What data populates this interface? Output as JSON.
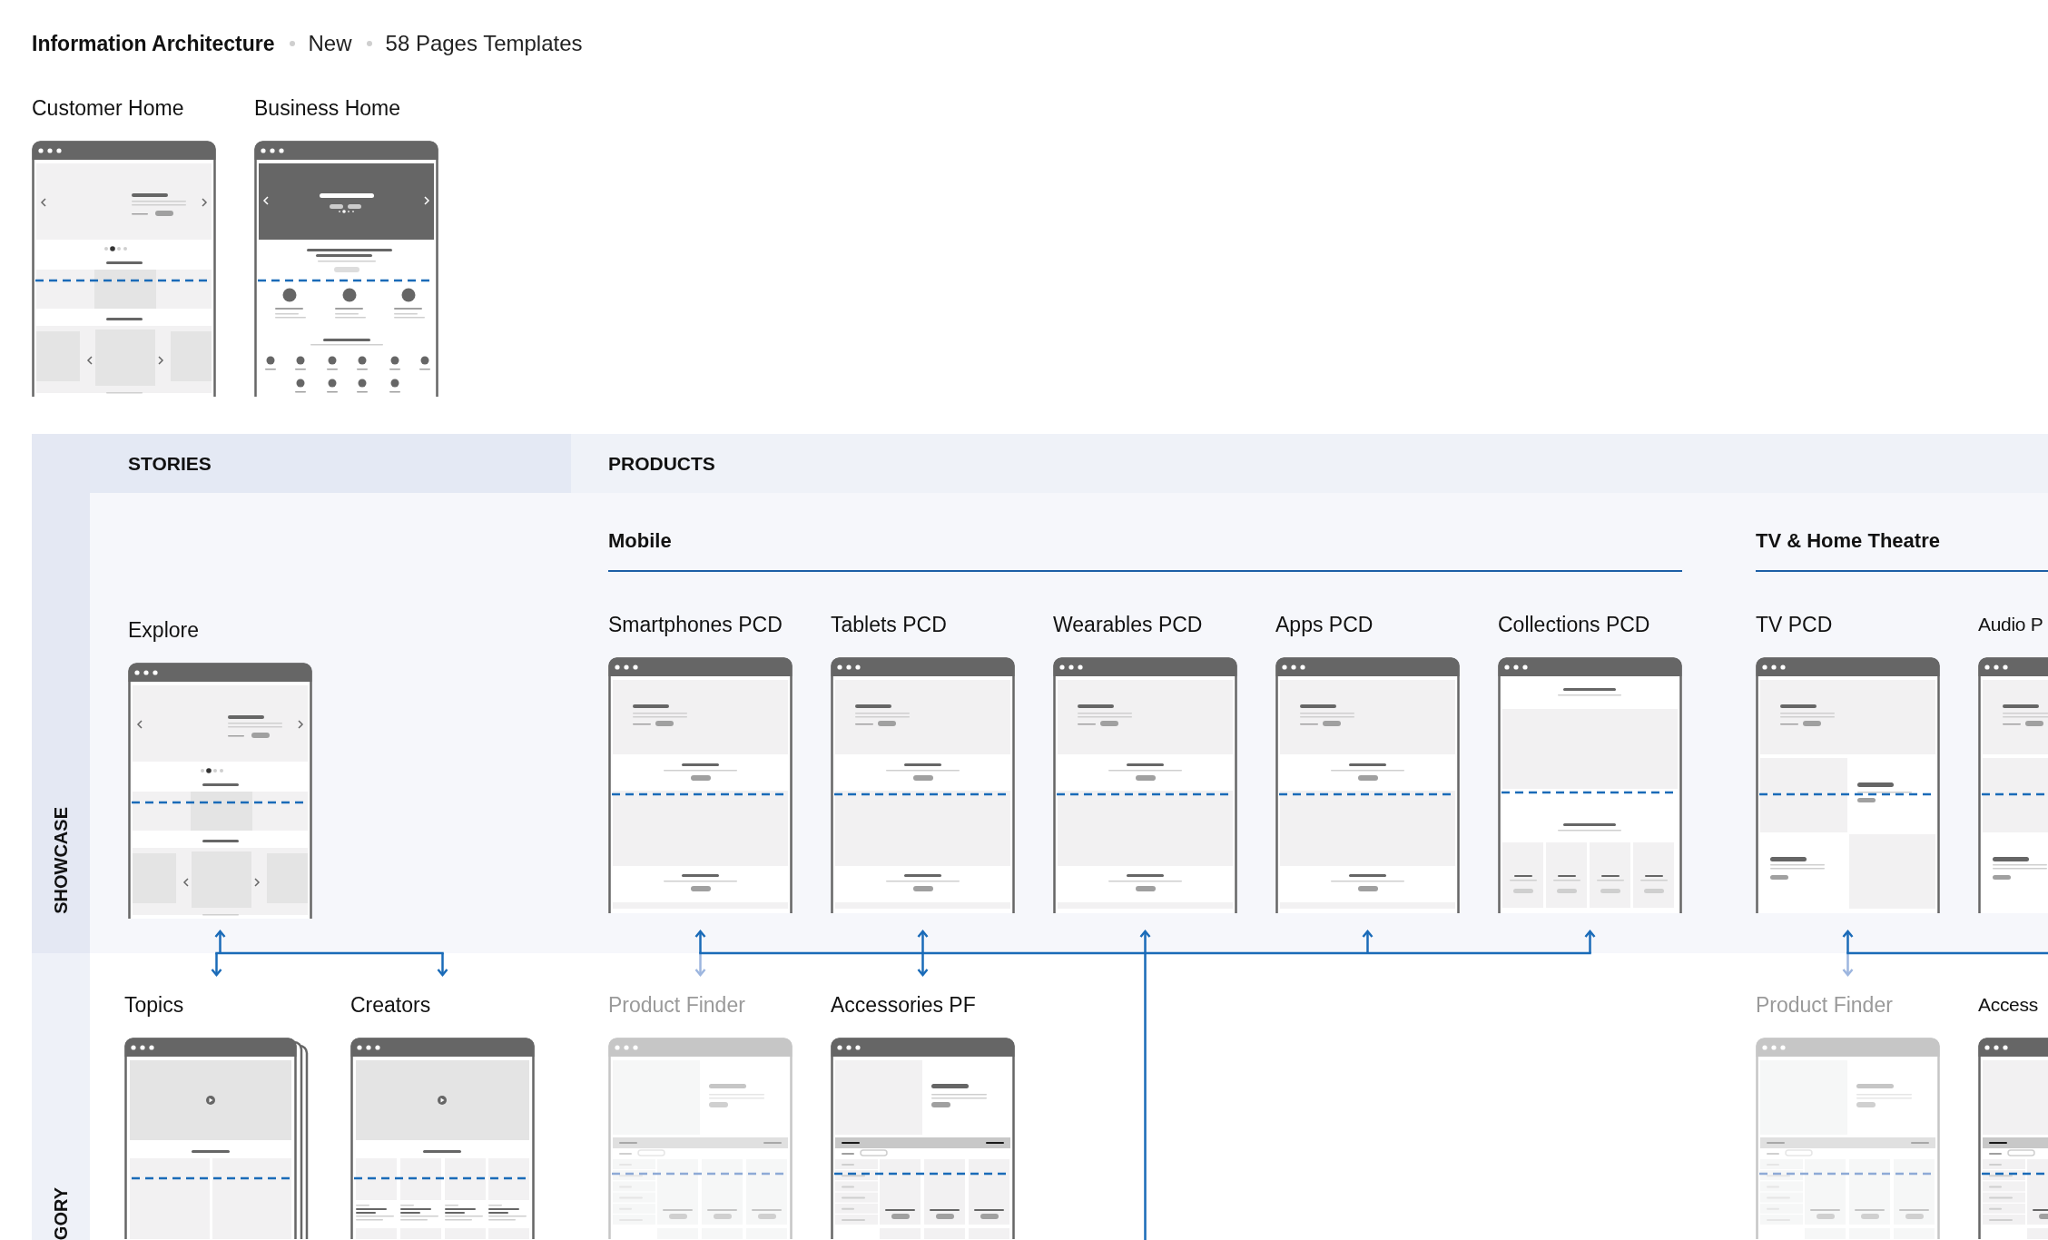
{
  "header": {
    "title": "Information Architecture",
    "items": [
      "New",
      "58 Pages Templates"
    ]
  },
  "home_pages": [
    {
      "label": "Customer Home",
      "kind": "home"
    },
    {
      "label": "Business Home",
      "kind": "business"
    }
  ],
  "columns": [
    {
      "label": "STORIES"
    },
    {
      "label": "PRODUCTS"
    }
  ],
  "rows": [
    {
      "label": "SHOWCASE"
    },
    {
      "label": "GORY"
    }
  ],
  "stories": {
    "showcase": [
      {
        "label": "Explore",
        "kind": "home"
      }
    ],
    "category": [
      {
        "label": "Topics",
        "kind": "topics",
        "muted": false
      },
      {
        "label": "Creators",
        "kind": "creators",
        "muted": false
      }
    ]
  },
  "product_groups": [
    {
      "label": "Mobile",
      "pages": [
        {
          "label": "Smartphones PCD",
          "kind": "pcd",
          "continues": false
        },
        {
          "label": "Tablets PCD",
          "kind": "pcd",
          "continues": false
        },
        {
          "label": "Wearables PCD",
          "kind": "pcd",
          "continues": true
        },
        {
          "label": "Apps PCD",
          "kind": "pcd",
          "continues": false
        },
        {
          "label": "Collections PCD",
          "kind": "collections",
          "continues": false
        }
      ],
      "category": [
        {
          "label": "Product Finder",
          "kind": "finder",
          "muted": true
        },
        {
          "label": "Accessories PF",
          "kind": "finder",
          "muted": false
        }
      ]
    },
    {
      "label": "TV & Home Theatre",
      "pages": [
        {
          "label": "TV PCD",
          "kind": "tv",
          "continues": false
        },
        {
          "label": "Audio P",
          "kind": "tv",
          "continues": false
        }
      ],
      "category": [
        {
          "label": "Product Finder",
          "kind": "finder",
          "muted": true
        },
        {
          "label": "Access",
          "kind": "finder",
          "muted": false
        }
      ]
    }
  ]
}
